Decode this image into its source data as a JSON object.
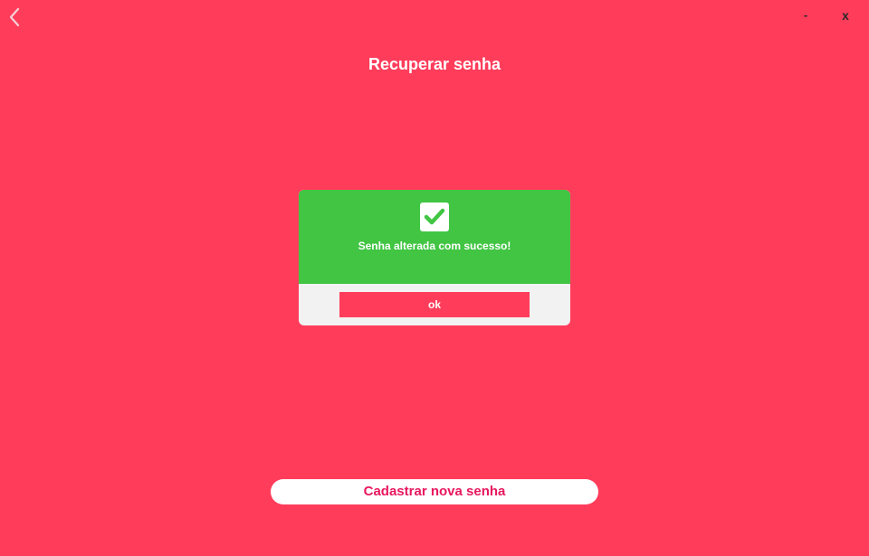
{
  "window": {
    "minimize_label": "-",
    "close_label": "x",
    "back_icon": "chevron-left-icon"
  },
  "header": {
    "title": "Recuperar senha"
  },
  "dialog": {
    "icon": "checkbox-checked-icon",
    "message": "Senha alterada com sucesso!",
    "ok_label": "ok"
  },
  "actions": {
    "register_label": "Cadastrar nova senha"
  },
  "colors": {
    "background": "#ff3d5b",
    "success": "#41c543",
    "dialog_footer": "#f2f2f2",
    "register_text": "#e8175d"
  }
}
